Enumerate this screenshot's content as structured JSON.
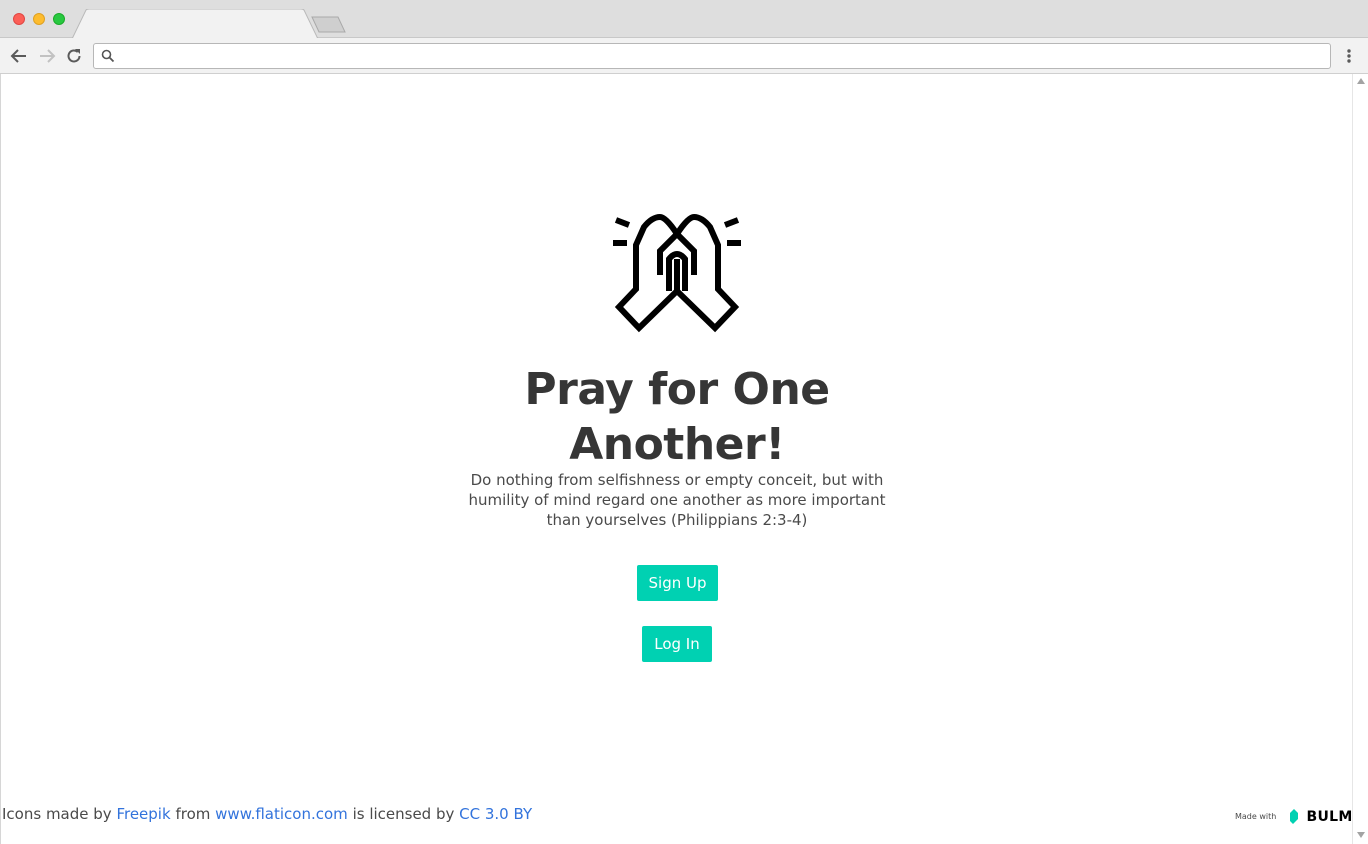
{
  "browser": {
    "address_bar": {
      "value": "",
      "placeholder": ""
    },
    "icons": [
      "back-icon",
      "forward-icon",
      "reload-icon",
      "search-icon",
      "menu-icon"
    ]
  },
  "hero": {
    "icon": "praying-hands-icon",
    "title": "Pray for One Another!",
    "subtitle": "Do nothing from selfishness or empty conceit, but with humility of mind regard one another as more important than yourselves (Philippians 2:3-4)"
  },
  "buttons": {
    "signup_label": "Sign Up",
    "login_label": "Log In"
  },
  "footer": {
    "credit_prefix": "Icons made by",
    "author_link": "Freepik",
    "from_text": "from",
    "site_link": "www.flaticon.com",
    "licensed_text": "is licensed by",
    "license_link": "CC 3.0 BY",
    "made_with": "Made with",
    "bulma": "BULMA"
  },
  "colors": {
    "primary": "#00d1b2",
    "link": "#3273dc",
    "title_text": "#363636",
    "body_text": "#4a4a4a"
  }
}
